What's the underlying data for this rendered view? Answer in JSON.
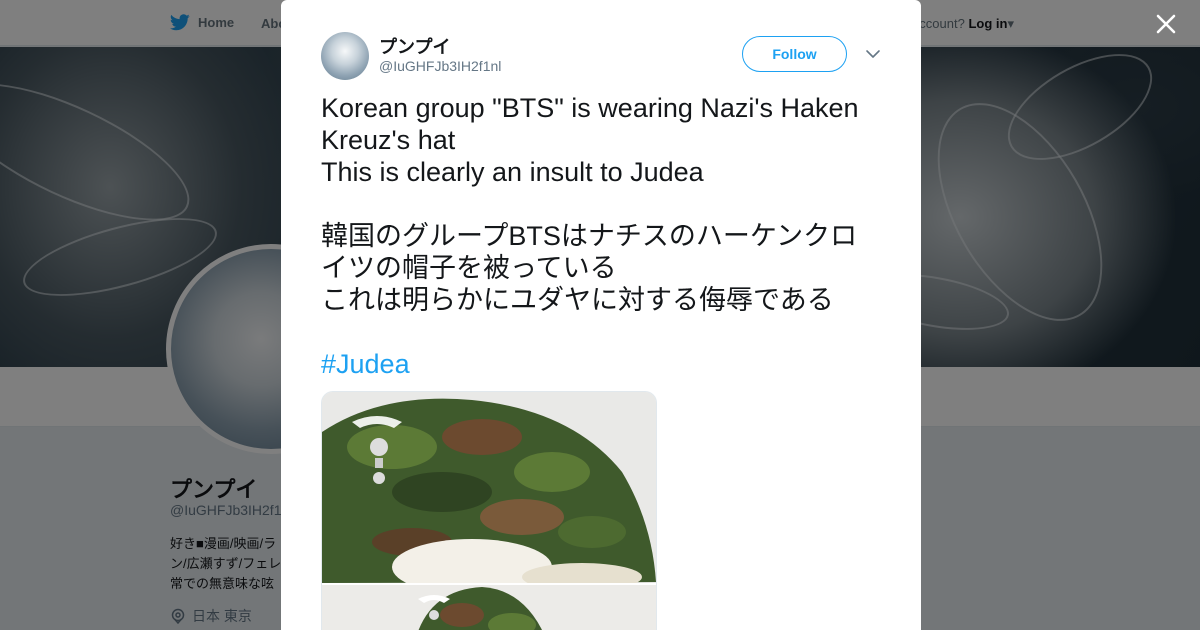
{
  "nav": {
    "home_label": "Home",
    "about_label": "Abo",
    "account_prompt": "ccount?",
    "login_label": "Log in"
  },
  "profile": {
    "name": "プンプイ",
    "handle": "@IuGHFJb3IH2f1",
    "bio_lines": [
      "好き■漫画/映画/ラ",
      "ン/広瀬すず/フェレ",
      "常での無意味な呟"
    ],
    "location": "日本 東京"
  },
  "tweet": {
    "author_name": "プンプイ",
    "author_handle": "@IuGHFJb3IH2f1nl",
    "follow_label": "Follow",
    "text": "Korean group \"BTS\" is wearing Nazi's Haken\nKreuz's hat\nThis is clearly an insult to Judea\n\n韓国のグループBTSはナチスのハーケンクロ\nイツの帽子を被っている\nこれは明らかにユダヤに対する侮辱である",
    "hashtag": "#Judea"
  },
  "icons": {
    "bird": "twitter-bird-icon",
    "close": "close-icon",
    "caret": "chevron-down-icon",
    "location": "location-pin-icon"
  },
  "colors": {
    "accent": "#1da1f2",
    "text": "#14171a",
    "muted": "#657786"
  }
}
